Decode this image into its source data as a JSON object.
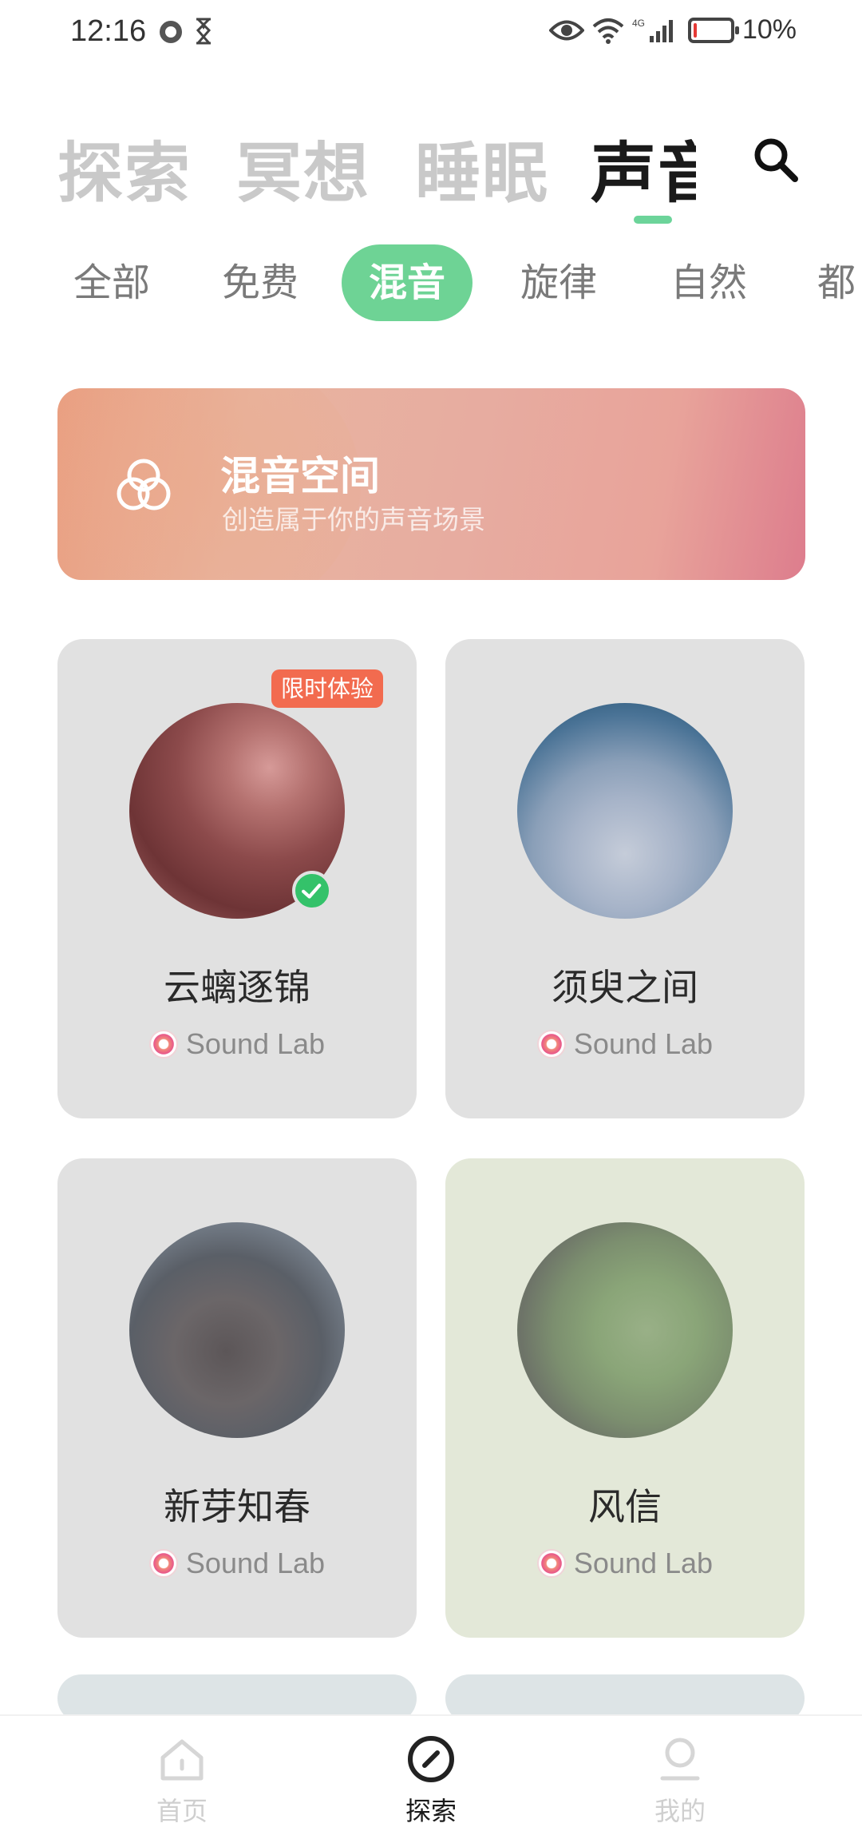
{
  "status_bar": {
    "time": "12:16",
    "battery_percent": "10%",
    "battery_level": 0.1,
    "network": "4G"
  },
  "top_tabs": [
    {
      "label": "探索"
    },
    {
      "label": "冥想"
    },
    {
      "label": "睡眠"
    },
    {
      "label": "声音",
      "active": true
    }
  ],
  "chips": [
    {
      "label": "全部"
    },
    {
      "label": "免费"
    },
    {
      "label": "混音",
      "active": true
    },
    {
      "label": "旋律"
    },
    {
      "label": "自然"
    },
    {
      "label": "都市"
    }
  ],
  "banner": {
    "title": "混音空间",
    "subtitle": "创造属于你的声音场景"
  },
  "cards": [
    {
      "title": "云螭逐锦",
      "source": "Sound Lab",
      "badge": "限时体验",
      "selected": true
    },
    {
      "title": "须臾之间",
      "source": "Sound Lab"
    },
    {
      "title": "新芽知春",
      "source": "Sound Lab"
    },
    {
      "title": "风信",
      "source": "Sound Lab"
    }
  ],
  "bottom_nav": [
    {
      "label": "首页",
      "icon": "home-icon"
    },
    {
      "label": "探索",
      "icon": "compass-icon",
      "active": true
    },
    {
      "label": "我的",
      "icon": "profile-icon"
    }
  ],
  "colors": {
    "accent": "#6ed395",
    "badge": "#f26b4f",
    "check": "#34c26a"
  }
}
